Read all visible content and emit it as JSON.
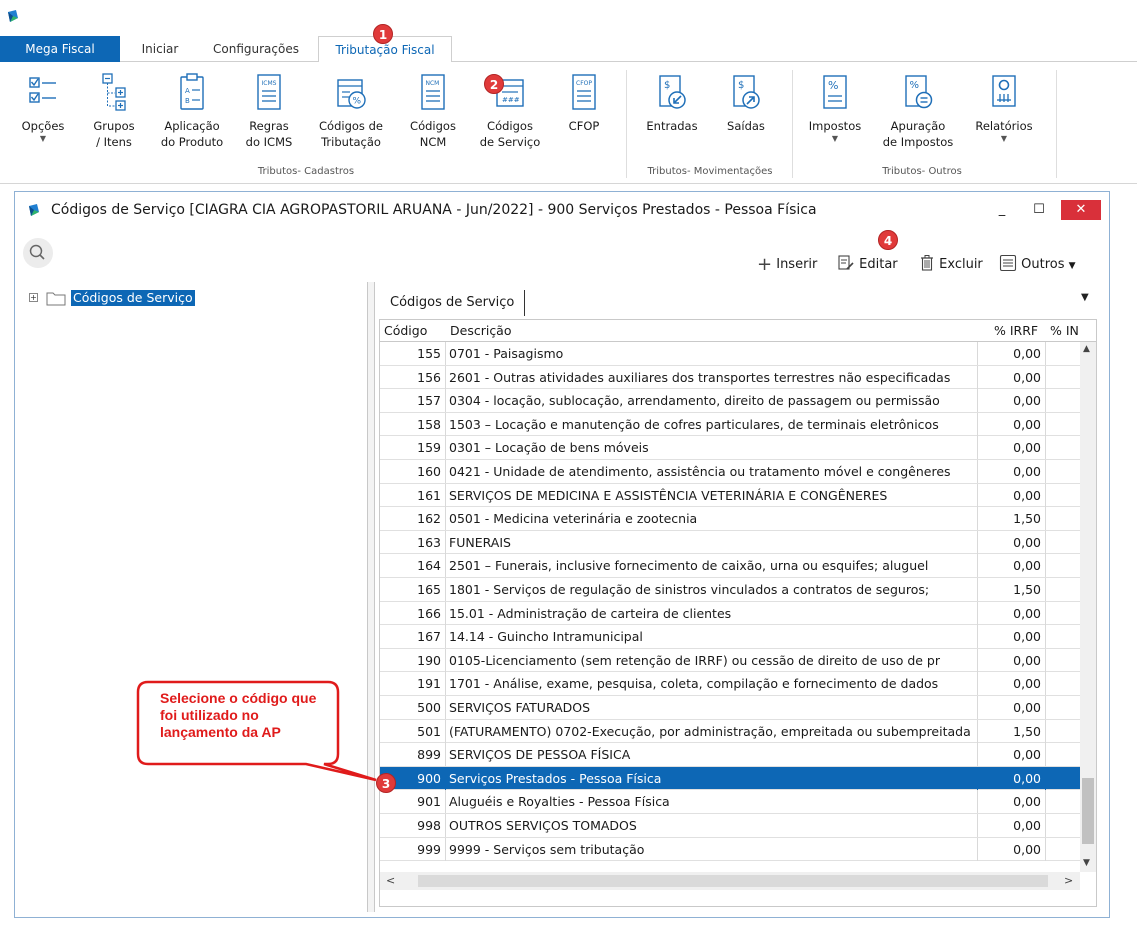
{
  "app": {
    "brand_tab": "Mega Fiscal",
    "tabs": [
      "Iniciar",
      "Configurações",
      "Tributação Fiscal"
    ]
  },
  "ribbon": {
    "groups": {
      "cadastros": "Tributos- Cadastros",
      "movimentacoes": "Tributos- Movimentações",
      "outros": "Tributos- Outros"
    },
    "buttons": {
      "opcoes": "Opções",
      "grupos": "Grupos\n/ Itens",
      "aplicacao": "Aplicação\ndo Produto",
      "regras": "Regras\ndo ICMS",
      "codigos_trib": "Códigos de\nTributação",
      "codigos_ncm": "Códigos\nNCM",
      "codigos_servico": "Códigos\nde Serviço",
      "cfop": "CFOP",
      "entradas": "Entradas",
      "saidas": "Saídas",
      "impostos": "Impostos",
      "apuracao": "Apuração\nde Impostos",
      "relatorios": "Relatórios"
    },
    "icon_texts": {
      "icms": "ICMS",
      "ncm": "NCM",
      "cfop": "CFOP",
      "dollar": "$",
      "percent": "%"
    }
  },
  "markers": [
    "1",
    "2",
    "3",
    "4"
  ],
  "window": {
    "title": "Códigos de Serviço [CIAGRA CIA AGROPASTORIL ARUANA - Jun/2022]  - 900 Serviços Prestados - Pessoa Física",
    "minimize": "_",
    "maximize": "☐",
    "close": "✕"
  },
  "toolbar": {
    "inserir": "Inserir",
    "editar": "Editar",
    "excluir": "Excluir",
    "outros": "Outros"
  },
  "tree": {
    "root_label": "Códigos de Serviço",
    "expander": "+"
  },
  "grid": {
    "tab_label": "Códigos de Serviço",
    "columns": [
      "Código",
      "Descrição",
      "% IRRF",
      "% IN"
    ],
    "selected_code": "900",
    "rows": [
      {
        "code": "155",
        "desc": "0701 - Paisagismo",
        "irrf": "0,00"
      },
      {
        "code": "156",
        "desc": "2601 - Outras atividades auxiliares dos transportes terrestres não especificadas",
        "irrf": "0,00"
      },
      {
        "code": "157",
        "desc": "0304 - locação, sublocação, arrendamento, direito de passagem ou permissão",
        "irrf": "0,00"
      },
      {
        "code": "158",
        "desc": "1503 – Locação e manutenção de cofres particulares, de terminais eletrônicos",
        "irrf": "0,00"
      },
      {
        "code": "159",
        "desc": "0301 – Locação de bens móveis",
        "irrf": "0,00"
      },
      {
        "code": "160",
        "desc": "0421 - Unidade de atendimento, assistência ou tratamento móvel e congêneres",
        "irrf": "0,00"
      },
      {
        "code": "161",
        "desc": "SERVIÇOS DE MEDICINA E ASSISTÊNCIA VETERINÁRIA E CONGÊNERES",
        "irrf": "0,00"
      },
      {
        "code": "162",
        "desc": "0501 - Medicina veterinária e zootecnia",
        "irrf": "1,50"
      },
      {
        "code": "163",
        "desc": "FUNERAIS",
        "irrf": "0,00"
      },
      {
        "code": "164",
        "desc": "2501 – Funerais, inclusive fornecimento de caixão, urna ou esquifes; aluguel",
        "irrf": "0,00"
      },
      {
        "code": "165",
        "desc": "1801 - Serviços de regulação de sinistros vinculados a contratos de seguros;",
        "irrf": "1,50"
      },
      {
        "code": "166",
        "desc": "15.01 - Administração de carteira de clientes",
        "irrf": "0,00"
      },
      {
        "code": "167",
        "desc": "14.14 - Guincho Intramunicipal",
        "irrf": "0,00"
      },
      {
        "code": "190",
        "desc": "0105-Licenciamento (sem retenção de IRRF) ou cessão de direito de uso de pr",
        "irrf": "0,00"
      },
      {
        "code": "191",
        "desc": "1701 - Análise, exame, pesquisa, coleta, compilação e fornecimento de dados",
        "irrf": "0,00"
      },
      {
        "code": "500",
        "desc": "SERVIÇOS FATURADOS",
        "irrf": "0,00"
      },
      {
        "code": "501",
        "desc": "(FATURAMENTO) 0702-Execução, por administração, empreitada ou subempreitada",
        "irrf": "1,50"
      },
      {
        "code": "899",
        "desc": "SERVIÇOS DE PESSOA FÍSICA",
        "irrf": "0,00"
      },
      {
        "code": "900",
        "desc": "Serviços Prestados - Pessoa Física",
        "irrf": "0,00"
      },
      {
        "code": "901",
        "desc": "Aluguéis e Royalties - Pessoa Física",
        "irrf": "0,00"
      },
      {
        "code": "998",
        "desc": "OUTROS SERVIÇOS TOMADOS",
        "irrf": "0,00"
      },
      {
        "code": "999",
        "desc": "9999 - Serviços sem tributação",
        "irrf": "0,00"
      }
    ]
  },
  "callout": {
    "text": "Selecione o código que foi utilizado no lançamento da AP"
  },
  "colors": {
    "brand": "#0d67b5",
    "marker": "#e03a3a",
    "callout": "#e01b1b"
  }
}
